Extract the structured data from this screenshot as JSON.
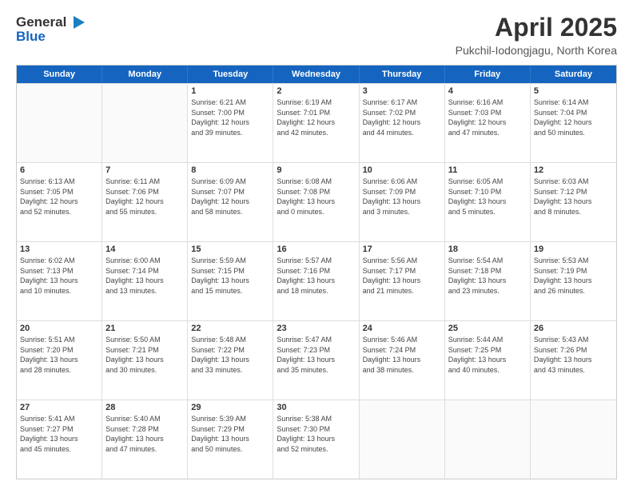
{
  "header": {
    "logo_line1": "General",
    "logo_line2": "Blue",
    "month": "April 2025",
    "location": "Pukchil-Iodongjagu, North Korea"
  },
  "days": [
    "Sunday",
    "Monday",
    "Tuesday",
    "Wednesday",
    "Thursday",
    "Friday",
    "Saturday"
  ],
  "rows": [
    [
      {
        "day": "",
        "empty": true
      },
      {
        "day": "",
        "empty": true
      },
      {
        "day": "1",
        "lines": [
          "Sunrise: 6:21 AM",
          "Sunset: 7:00 PM",
          "Daylight: 12 hours",
          "and 39 minutes."
        ]
      },
      {
        "day": "2",
        "lines": [
          "Sunrise: 6:19 AM",
          "Sunset: 7:01 PM",
          "Daylight: 12 hours",
          "and 42 minutes."
        ]
      },
      {
        "day": "3",
        "lines": [
          "Sunrise: 6:17 AM",
          "Sunset: 7:02 PM",
          "Daylight: 12 hours",
          "and 44 minutes."
        ]
      },
      {
        "day": "4",
        "lines": [
          "Sunrise: 6:16 AM",
          "Sunset: 7:03 PM",
          "Daylight: 12 hours",
          "and 47 minutes."
        ]
      },
      {
        "day": "5",
        "lines": [
          "Sunrise: 6:14 AM",
          "Sunset: 7:04 PM",
          "Daylight: 12 hours",
          "and 50 minutes."
        ]
      }
    ],
    [
      {
        "day": "6",
        "lines": [
          "Sunrise: 6:13 AM",
          "Sunset: 7:05 PM",
          "Daylight: 12 hours",
          "and 52 minutes."
        ]
      },
      {
        "day": "7",
        "lines": [
          "Sunrise: 6:11 AM",
          "Sunset: 7:06 PM",
          "Daylight: 12 hours",
          "and 55 minutes."
        ]
      },
      {
        "day": "8",
        "lines": [
          "Sunrise: 6:09 AM",
          "Sunset: 7:07 PM",
          "Daylight: 12 hours",
          "and 58 minutes."
        ]
      },
      {
        "day": "9",
        "lines": [
          "Sunrise: 6:08 AM",
          "Sunset: 7:08 PM",
          "Daylight: 13 hours",
          "and 0 minutes."
        ]
      },
      {
        "day": "10",
        "lines": [
          "Sunrise: 6:06 AM",
          "Sunset: 7:09 PM",
          "Daylight: 13 hours",
          "and 3 minutes."
        ]
      },
      {
        "day": "11",
        "lines": [
          "Sunrise: 6:05 AM",
          "Sunset: 7:10 PM",
          "Daylight: 13 hours",
          "and 5 minutes."
        ]
      },
      {
        "day": "12",
        "lines": [
          "Sunrise: 6:03 AM",
          "Sunset: 7:12 PM",
          "Daylight: 13 hours",
          "and 8 minutes."
        ]
      }
    ],
    [
      {
        "day": "13",
        "lines": [
          "Sunrise: 6:02 AM",
          "Sunset: 7:13 PM",
          "Daylight: 13 hours",
          "and 10 minutes."
        ]
      },
      {
        "day": "14",
        "lines": [
          "Sunrise: 6:00 AM",
          "Sunset: 7:14 PM",
          "Daylight: 13 hours",
          "and 13 minutes."
        ]
      },
      {
        "day": "15",
        "lines": [
          "Sunrise: 5:59 AM",
          "Sunset: 7:15 PM",
          "Daylight: 13 hours",
          "and 15 minutes."
        ]
      },
      {
        "day": "16",
        "lines": [
          "Sunrise: 5:57 AM",
          "Sunset: 7:16 PM",
          "Daylight: 13 hours",
          "and 18 minutes."
        ]
      },
      {
        "day": "17",
        "lines": [
          "Sunrise: 5:56 AM",
          "Sunset: 7:17 PM",
          "Daylight: 13 hours",
          "and 21 minutes."
        ]
      },
      {
        "day": "18",
        "lines": [
          "Sunrise: 5:54 AM",
          "Sunset: 7:18 PM",
          "Daylight: 13 hours",
          "and 23 minutes."
        ]
      },
      {
        "day": "19",
        "lines": [
          "Sunrise: 5:53 AM",
          "Sunset: 7:19 PM",
          "Daylight: 13 hours",
          "and 26 minutes."
        ]
      }
    ],
    [
      {
        "day": "20",
        "lines": [
          "Sunrise: 5:51 AM",
          "Sunset: 7:20 PM",
          "Daylight: 13 hours",
          "and 28 minutes."
        ]
      },
      {
        "day": "21",
        "lines": [
          "Sunrise: 5:50 AM",
          "Sunset: 7:21 PM",
          "Daylight: 13 hours",
          "and 30 minutes."
        ]
      },
      {
        "day": "22",
        "lines": [
          "Sunrise: 5:48 AM",
          "Sunset: 7:22 PM",
          "Daylight: 13 hours",
          "and 33 minutes."
        ]
      },
      {
        "day": "23",
        "lines": [
          "Sunrise: 5:47 AM",
          "Sunset: 7:23 PM",
          "Daylight: 13 hours",
          "and 35 minutes."
        ]
      },
      {
        "day": "24",
        "lines": [
          "Sunrise: 5:46 AM",
          "Sunset: 7:24 PM",
          "Daylight: 13 hours",
          "and 38 minutes."
        ]
      },
      {
        "day": "25",
        "lines": [
          "Sunrise: 5:44 AM",
          "Sunset: 7:25 PM",
          "Daylight: 13 hours",
          "and 40 minutes."
        ]
      },
      {
        "day": "26",
        "lines": [
          "Sunrise: 5:43 AM",
          "Sunset: 7:26 PM",
          "Daylight: 13 hours",
          "and 43 minutes."
        ]
      }
    ],
    [
      {
        "day": "27",
        "lines": [
          "Sunrise: 5:41 AM",
          "Sunset: 7:27 PM",
          "Daylight: 13 hours",
          "and 45 minutes."
        ]
      },
      {
        "day": "28",
        "lines": [
          "Sunrise: 5:40 AM",
          "Sunset: 7:28 PM",
          "Daylight: 13 hours",
          "and 47 minutes."
        ]
      },
      {
        "day": "29",
        "lines": [
          "Sunrise: 5:39 AM",
          "Sunset: 7:29 PM",
          "Daylight: 13 hours",
          "and 50 minutes."
        ]
      },
      {
        "day": "30",
        "lines": [
          "Sunrise: 5:38 AM",
          "Sunset: 7:30 PM",
          "Daylight: 13 hours",
          "and 52 minutes."
        ]
      },
      {
        "day": "",
        "empty": true
      },
      {
        "day": "",
        "empty": true
      },
      {
        "day": "",
        "empty": true
      }
    ]
  ]
}
